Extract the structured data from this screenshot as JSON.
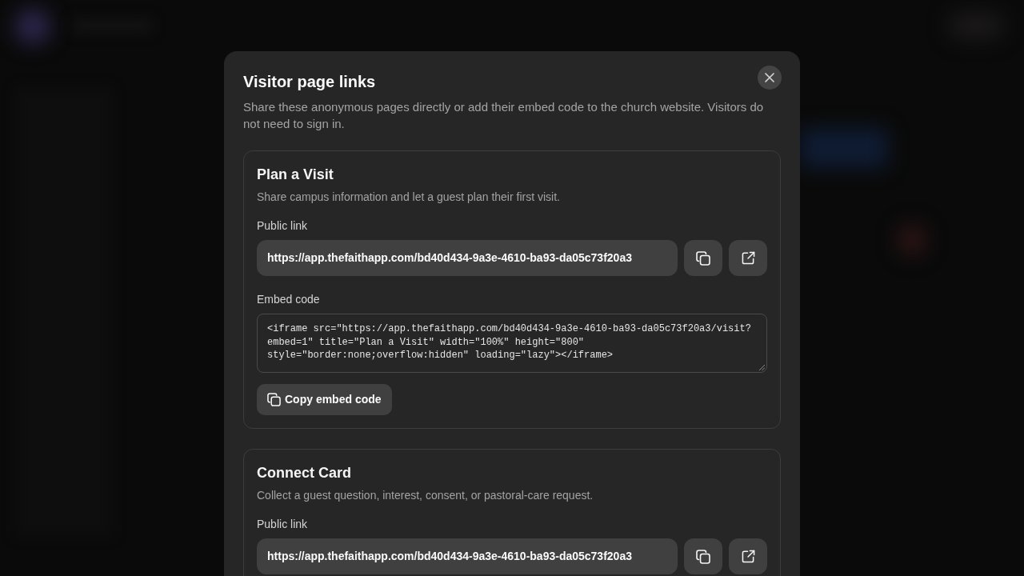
{
  "dialog": {
    "title": "Visitor page links",
    "description": "Share these anonymous pages directly or add their embed code to the church website. Visitors do not need to sign in.",
    "sections": [
      {
        "title": "Plan a Visit",
        "description": "Share campus information and let a guest plan their first visit.",
        "link_label": "Public link",
        "link": "https://app.thefaithapp.com/bd40d434-9a3e-4610-ba93-da05c73f20a3",
        "embed_label": "Embed code",
        "embed_code_lines": [
          "<iframe src=\"https://app.thefaithapp.com/bd40d434-9a3e-4610-ba93-da05c73f20a3/visit?",
          "embed=1\" title=\"Plan a Visit\" width=\"100%\" height=\"800\"",
          "style=\"border:none;overflow:hidden\" loading=\"lazy\"></iframe>"
        ],
        "copy_embed_button": "Copy embed code"
      },
      {
        "title": "Connect Card",
        "description": "Collect a guest question, interest, consent, or pastoral-care request.",
        "link_label": "Public link",
        "link": "https://app.thefaithapp.com/bd40d434-9a3e-4610-ba93-da05c73f20a3"
      }
    ]
  }
}
